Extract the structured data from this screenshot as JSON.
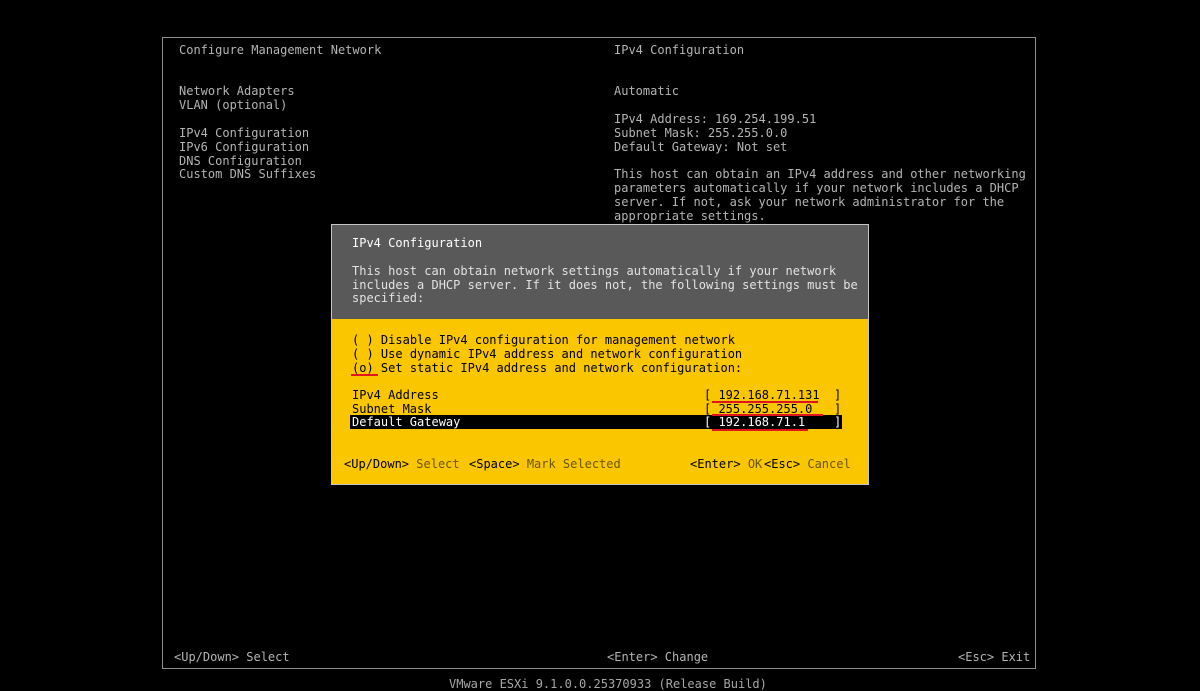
{
  "left_panel": {
    "title": "Configure Management Network",
    "menu_items": [
      "Network Adapters",
      "VLAN (optional)",
      "IPv4 Configuration",
      "IPv6 Configuration",
      "DNS Configuration",
      "Custom DNS Suffixes"
    ]
  },
  "right_panel": {
    "title": "IPv4 Configuration",
    "mode": "Automatic",
    "ipv4_address": "IPv4 Address: 169.254.199.51",
    "subnet_mask": "Subnet Mask: 255.255.0.0",
    "default_gateway": "Default Gateway: Not set",
    "description_lines": [
      "This host can obtain an IPv4 address and other networking",
      "parameters automatically if your network includes a DHCP",
      "server. If not, ask your network administrator for the",
      "appropriate settings."
    ]
  },
  "dialog": {
    "title": "IPv4 Configuration",
    "description_lines": [
      "This host can obtain network settings automatically if your network",
      "includes a DHCP server. If it does not, the following settings must be",
      "specified:"
    ],
    "options": [
      {
        "marker": "( )",
        "label": "Disable IPv4 configuration for management network"
      },
      {
        "marker": "( )",
        "label": "Use dynamic IPv4 address and network configuration"
      },
      {
        "marker": "(o)",
        "label": "Set static IPv4 address and network configuration:"
      }
    ],
    "fields": [
      {
        "label": "IPv4 Address",
        "value": "192.168.71.131"
      },
      {
        "label": "Subnet Mask",
        "value": "255.255.255.0"
      },
      {
        "label": "Default Gateway",
        "value": "192.168.71.1"
      }
    ],
    "hints": {
      "updown_key": "<Up/Down>",
      "updown_text": "Select",
      "space_key": "<Space>",
      "space_text": "Mark Selected",
      "enter_key": "<Enter>",
      "enter_text": "OK",
      "esc_key": "<Esc>",
      "esc_text": "Cancel"
    }
  },
  "footer": {
    "left": "<Up/Down> Select",
    "center": "<Enter> Change",
    "right": "<Esc> Exit",
    "build": "VMware ESXi 9.1.0.0.25370933 (Release Build)"
  },
  "colors": {
    "background": "#000000",
    "dialog_yellow": "#f9c600",
    "dialog_header_gray": "#595959",
    "annotation_red": "#e0151d"
  }
}
